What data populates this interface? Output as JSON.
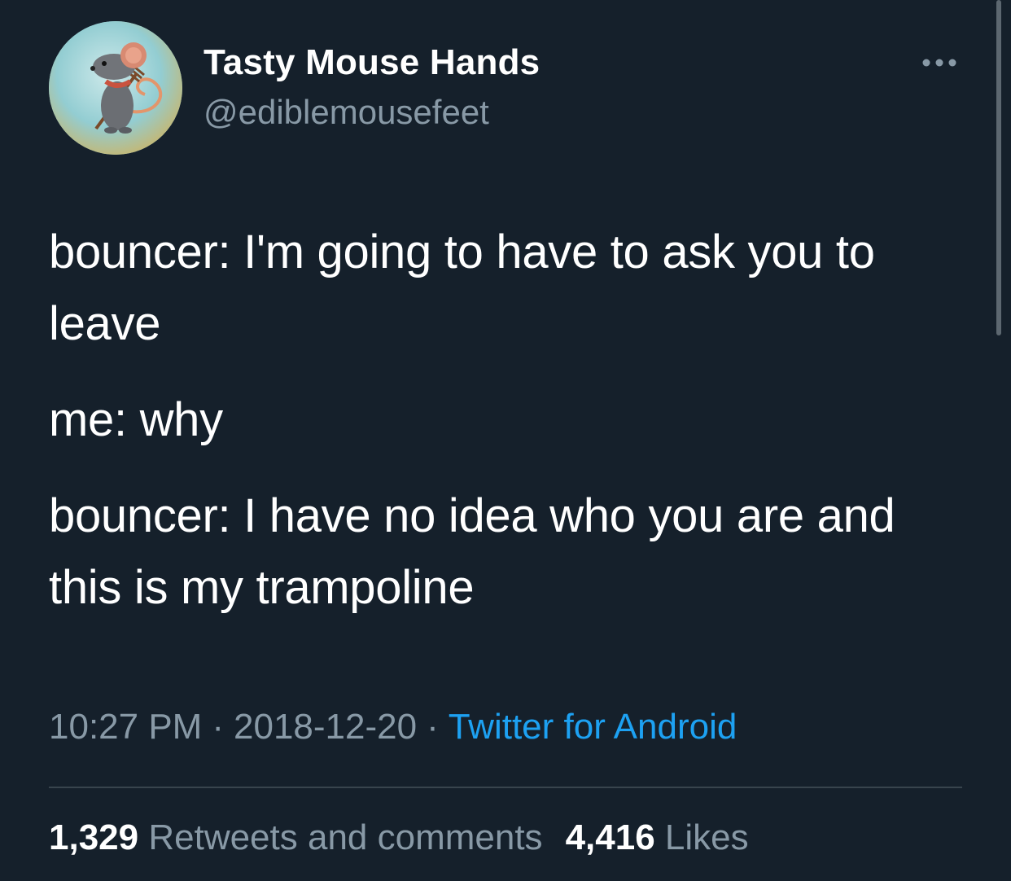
{
  "author": {
    "display_name": "Tasty Mouse Hands",
    "handle": "@ediblemousefeet",
    "avatar_icon": "mouse-with-pitchfork-illustration"
  },
  "tweet": {
    "lines": [
      "bouncer: I'm going to have to ask you to leave",
      "me: why",
      "bouncer: I have no idea who you are and this is my trampoline"
    ],
    "time": "10:27 PM",
    "separator": "·",
    "date": "2018-12-20",
    "source": "Twitter for Android"
  },
  "stats": {
    "retweets_count": "1,329",
    "retweets_label": "Retweets and comments",
    "likes_count": "4,416",
    "likes_label": "Likes"
  },
  "colors": {
    "background": "#15202b",
    "primary_text": "#ffffff",
    "secondary_text": "#8899a6",
    "link": "#1da1f2",
    "divider": "#38444d"
  },
  "icons": {
    "more": "more-horizontal-icon"
  }
}
